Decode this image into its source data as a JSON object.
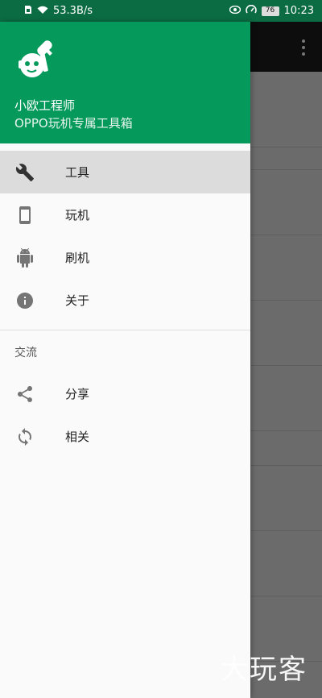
{
  "status_bar": {
    "speed": "53.3B/s",
    "battery": "76",
    "time": "10:23"
  },
  "drawer": {
    "app_name": "小欧工程师",
    "app_subtitle": "OPPO玩机专属工具箱",
    "menu": [
      {
        "label": "工具",
        "icon": "wrench-icon",
        "active": true
      },
      {
        "label": "玩机",
        "icon": "phone-icon",
        "active": false
      },
      {
        "label": "刷机",
        "icon": "android-icon",
        "active": false
      },
      {
        "label": "关于",
        "icon": "info-icon",
        "active": false
      }
    ],
    "section_title": "交流",
    "section_items": [
      {
        "label": "分享",
        "icon": "share-icon"
      },
      {
        "label": "相关",
        "icon": "sync-icon"
      }
    ]
  },
  "watermark": "大玩客",
  "colors": {
    "header_green": "#05995c",
    "statusbar_green": "#0b6b42",
    "active_bg": "#dcdcdc"
  }
}
